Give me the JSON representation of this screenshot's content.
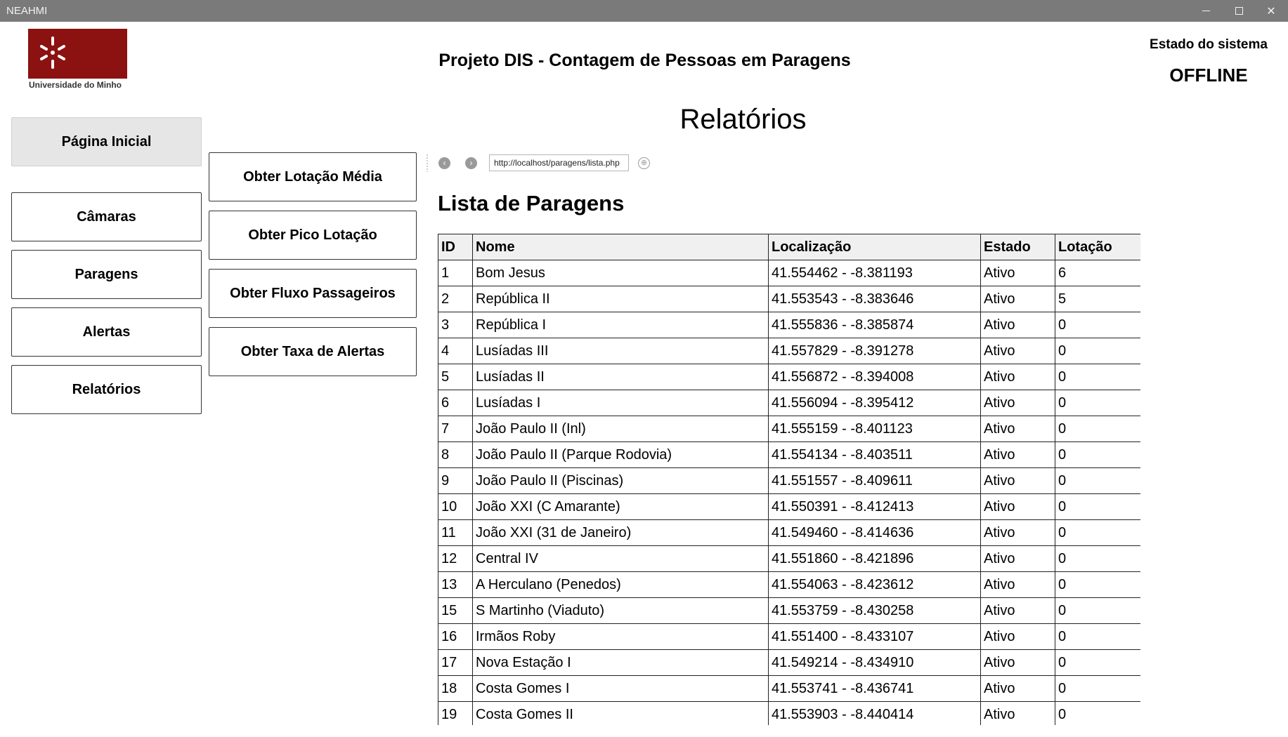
{
  "window": {
    "title": "NEAHMI"
  },
  "logo": {
    "text": "Universidade do Minho"
  },
  "header": {
    "app_title": "Projeto DIS - Contagem de Pessoas em Paragens",
    "system_status_label": "Estado do sistema",
    "system_status_value": "OFFLINE"
  },
  "nav": {
    "items": [
      {
        "label": "Página Inicial"
      },
      {
        "label": "Câmaras"
      },
      {
        "label": "Paragens"
      },
      {
        "label": "Alertas"
      },
      {
        "label": "Relatórios"
      }
    ]
  },
  "page": {
    "heading": "Relatórios"
  },
  "reports": {
    "buttons": [
      {
        "label": "Obter Lotação Média"
      },
      {
        "label": "Obter Pico Lotação"
      },
      {
        "label": "Obter Fluxo Passageiros"
      },
      {
        "label": "Obter Taxa de Alertas"
      }
    ]
  },
  "browser": {
    "url": "http://localhost/paragens/lista.php"
  },
  "list": {
    "heading": "Lista de Paragens",
    "columns": [
      "ID",
      "Nome",
      "Localização",
      "Estado",
      "Lotação"
    ],
    "rows": [
      [
        "1",
        "Bom Jesus",
        "41.554462 - -8.381193",
        "Ativo",
        "6"
      ],
      [
        "2",
        "República II",
        "41.553543 - -8.383646",
        "Ativo",
        "5"
      ],
      [
        "3",
        "República I",
        "41.555836 - -8.385874",
        "Ativo",
        "0"
      ],
      [
        "4",
        "Lusíadas III",
        "41.557829 - -8.391278",
        "Ativo",
        "0"
      ],
      [
        "5",
        "Lusíadas II",
        "41.556872 - -8.394008",
        "Ativo",
        "0"
      ],
      [
        "6",
        "Lusíadas I",
        "41.556094 - -8.395412",
        "Ativo",
        "0"
      ],
      [
        "7",
        "João Paulo II (Inl)",
        "41.555159 - -8.401123",
        "Ativo",
        "0"
      ],
      [
        "8",
        "João Paulo II (Parque Rodovia)",
        "41.554134 - -8.403511",
        "Ativo",
        "0"
      ],
      [
        "9",
        "João Paulo II (Piscinas)",
        "41.551557 - -8.409611",
        "Ativo",
        "0"
      ],
      [
        "10",
        "João XXI (C Amarante)",
        "41.550391 - -8.412413",
        "Ativo",
        "0"
      ],
      [
        "11",
        "João XXI (31 de Janeiro)",
        "41.549460 - -8.414636",
        "Ativo",
        "0"
      ],
      [
        "12",
        "Central IV",
        "41.551860 - -8.421896",
        "Ativo",
        "0"
      ],
      [
        "13",
        "A Herculano (Penedos)",
        "41.554063 - -8.423612",
        "Ativo",
        "0"
      ],
      [
        "15",
        "S Martinho (Viaduto)",
        "41.553759 - -8.430258",
        "Ativo",
        "0"
      ],
      [
        "16",
        "Irmãos Roby",
        "41.551400 - -8.433107",
        "Ativo",
        "0"
      ],
      [
        "17",
        "Nova Estação I",
        "41.549214 - -8.434910",
        "Ativo",
        "0"
      ],
      [
        "18",
        "Costa Gomes I",
        "41.553741 - -8.436741",
        "Ativo",
        "0"
      ],
      [
        "19",
        "Costa Gomes II",
        "41.553903 - -8.440414",
        "Ativo",
        "0"
      ]
    ]
  },
  "colors": {
    "logo_bg": "#8c1111",
    "titlebar_bg": "#7a7a7a",
    "active_nav_bg": "#e6e6e6"
  }
}
